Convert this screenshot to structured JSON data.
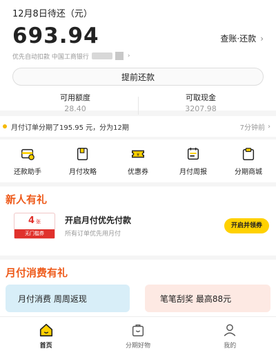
{
  "header": {
    "due_title": "12月8日待还（元）",
    "amount": "693.94",
    "bill_link": "查账·还款",
    "autopay": "优先自动扣款 中国工商银行",
    "prepay_button": "提前还款"
  },
  "quota": [
    {
      "label": "可用额度",
      "value": "28.40"
    },
    {
      "label": "可取现金",
      "value": "3207.98"
    }
  ],
  "notice": {
    "text": "月付订单分期了195.95 元，分为12期",
    "time": "7分钟前"
  },
  "grid": [
    {
      "label": "还款助手",
      "icon": "repayment-helper-icon"
    },
    {
      "label": "月付攻略",
      "icon": "guide-book-icon"
    },
    {
      "label": "优惠券",
      "icon": "coupon-icon"
    },
    {
      "label": "月付周报",
      "icon": "weekly-report-icon"
    },
    {
      "label": "分期商城",
      "icon": "shopping-bag-icon"
    }
  ],
  "newuser": {
    "title": "新人有礼",
    "coupon_count": "4",
    "coupon_unit": "张",
    "coupon_tag": "无门槛券",
    "coupon_title": "开启月付优先付款",
    "coupon_sub": "所有订单优先用月付",
    "claim_button": "开启并领券"
  },
  "spend": {
    "title": "月付消费有礼",
    "promo_left": "月付消费 周周返现",
    "promo_right": "笔笔刮奖 最高88元"
  },
  "nav": [
    {
      "label": "首页",
      "icon": "home-icon"
    },
    {
      "label": "分期好物",
      "icon": "installment-goods-icon"
    },
    {
      "label": "我的",
      "icon": "profile-icon"
    }
  ],
  "colors": {
    "accent_yellow": "#ffd100",
    "section_orange": "#ee5a1a",
    "coupon_red": "#e0312c"
  }
}
